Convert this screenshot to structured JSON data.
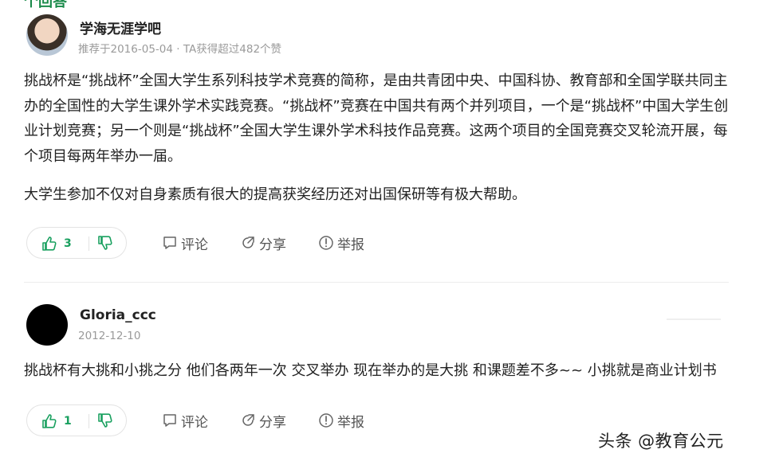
{
  "header_fragment": "个回答",
  "answers": [
    {
      "username": "学海无涯学吧",
      "meta": "推荐于2016-05-04 · TA获得超过482个赞",
      "paragraphs": [
        "挑战杯是“挑战杯”全国大学生系列科技学术竞赛的简称，是由共青团中央、中国科协、教育部和全国学联共同主办的全国性的大学生课外学术实践竞赛。“挑战杯”竞赛在中国共有两个并列项目，一个是“挑战杯”中国大学生创业计划竞赛；另一个则是“挑战杯”全国大学生课外学术科技作品竞赛。这两个项目的全国竞赛交叉轮流开展，每个项目每两年举办一届。",
        "大学生参加不仅对自身素质有很大的提高获奖经历还对出国保研等有极大帮助。"
      ],
      "likes": "3",
      "comment_label": "评论",
      "share_label": "分享",
      "report_label": "举报"
    },
    {
      "username": "Gloria_ccc",
      "meta": "2012-12-10",
      "paragraphs": [
        "挑战杯有大挑和小挑之分 他们各两年一次 交叉举办 现在举办的是大挑 和课题差不多~~ 小挑就是商业计划书"
      ],
      "likes": "1",
      "comment_label": "评论",
      "share_label": "分享",
      "report_label": "举报"
    }
  ],
  "watermark": "头条 @教育公元",
  "colors": {
    "accent_green": "#19a05f",
    "text": "#222222",
    "muted": "#9a9a9a",
    "border": "#e3e3e3"
  },
  "icons": [
    "thumbs-up-icon",
    "thumbs-down-icon",
    "comment-icon",
    "share-icon",
    "report-icon"
  ]
}
